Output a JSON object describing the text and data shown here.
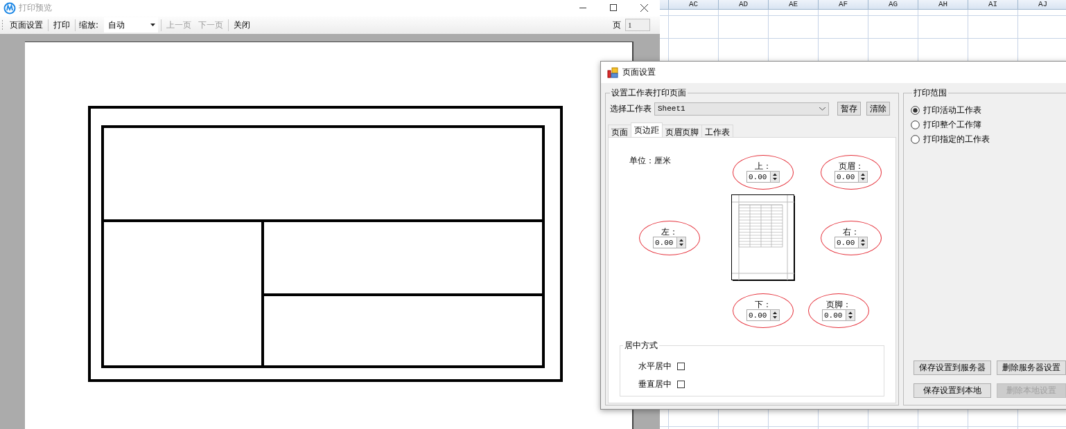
{
  "preview_window": {
    "title": "打印预览",
    "toolbar": [
      {
        "kind": "button",
        "label": "页面设置",
        "disabled": false
      },
      {
        "kind": "separator"
      },
      {
        "kind": "button",
        "label": "打印",
        "disabled": false
      },
      {
        "kind": "separator"
      },
      {
        "kind": "label",
        "label": "缩放:"
      },
      {
        "kind": "dropdown",
        "label": "自动"
      },
      {
        "kind": "separator"
      },
      {
        "kind": "button",
        "label": "上一页",
        "disabled": true
      },
      {
        "kind": "button",
        "label": "下一页",
        "disabled": true
      },
      {
        "kind": "separator"
      },
      {
        "kind": "button",
        "label": "关闭",
        "disabled": false
      }
    ],
    "page_label": "页",
    "page_field": {
      "value": "1",
      "disabled": true
    }
  },
  "spreadsheet": {
    "columns": [
      "AC",
      "AD",
      "AE",
      "AF",
      "AG",
      "AH",
      "AI",
      "AJ"
    ]
  },
  "page_setup": {
    "title": "页面设置",
    "sheet_group": {
      "title": "设置工作表打印页面",
      "select_label": "选择工作表",
      "select_value": "Sheet1",
      "buttons": [
        "暂存",
        "清除"
      ]
    },
    "tabs": [
      {
        "label": "页面",
        "selected": false
      },
      {
        "label": "页边距",
        "selected": true
      },
      {
        "label": "页眉页脚",
        "selected": false
      },
      {
        "label": "工作表",
        "selected": false
      }
    ],
    "unit": "单位：厘米",
    "margins": [
      {
        "kind": "top",
        "label": "上：",
        "value": "0.00"
      },
      {
        "kind": "header",
        "label": "页眉：",
        "value": "0.00"
      },
      {
        "kind": "left",
        "label": "左：",
        "value": "0.00"
      },
      {
        "kind": "right",
        "label": "右：",
        "value": "0.00"
      },
      {
        "kind": "bottom",
        "label": "下：",
        "value": "0.00"
      },
      {
        "kind": "footer",
        "label": "页脚：",
        "value": "0.00"
      }
    ],
    "centering": {
      "title": "居中方式",
      "options": [
        {
          "label": "水平居中",
          "checked": false
        },
        {
          "label": "垂直居中",
          "checked": false
        }
      ]
    },
    "range": {
      "title": "打印范围",
      "options": [
        {
          "label": "打印活动工作表",
          "selected": true
        },
        {
          "label": "打印整个工作簿",
          "selected": false
        },
        {
          "label": "打印指定的工作表",
          "selected": false
        }
      ]
    },
    "buttons": [
      {
        "label": "保存设置到服务器",
        "disabled": false
      },
      {
        "label": "删除服务器设置",
        "disabled": false
      },
      {
        "label": "保存设置到本地",
        "disabled": false
      },
      {
        "label": "删除本地设置",
        "disabled": true
      }
    ]
  }
}
